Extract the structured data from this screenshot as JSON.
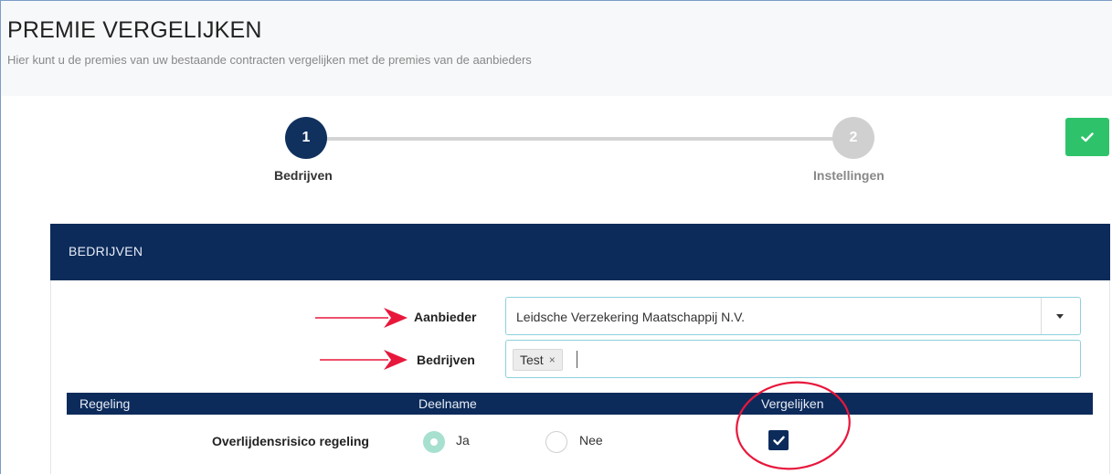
{
  "page": {
    "title": "PREMIE VERGELIJKEN",
    "subtitle": "Hier kunt u de premies van uw bestaande contracten vergelijken met de premies van de aanbieders"
  },
  "steps": [
    {
      "number": "1",
      "label": "Bedrijven",
      "state": "active"
    },
    {
      "number": "2",
      "label": "Instellingen",
      "state": "inactive"
    }
  ],
  "confirm_button": {
    "icon": "check-icon",
    "color": "#2ec36a"
  },
  "panel": {
    "title": "BEDRIJVEN",
    "aanbieder_label": "Aanbieder",
    "aanbieder_value": "Leidsche Verzekering Maatschappij N.V.",
    "bedrijven_label": "Bedrijven",
    "bedrijven_tags": [
      "Test"
    ],
    "tag_remove_symbol": "×"
  },
  "table": {
    "headers": [
      "Regeling",
      "Deelname",
      "Vergelijken"
    ],
    "rows": [
      {
        "regeling": "Overlijdensrisico regeling",
        "deelname_options": [
          "Ja",
          "Nee"
        ],
        "deelname_selected": "Ja",
        "vergelijken_checked": true
      }
    ]
  },
  "colors": {
    "navy": "#0c2b5b",
    "step_active": "#10305e",
    "step_inactive": "#d0d0d0",
    "annotation_red": "#e8173c",
    "input_border": "#8fd0dc"
  }
}
